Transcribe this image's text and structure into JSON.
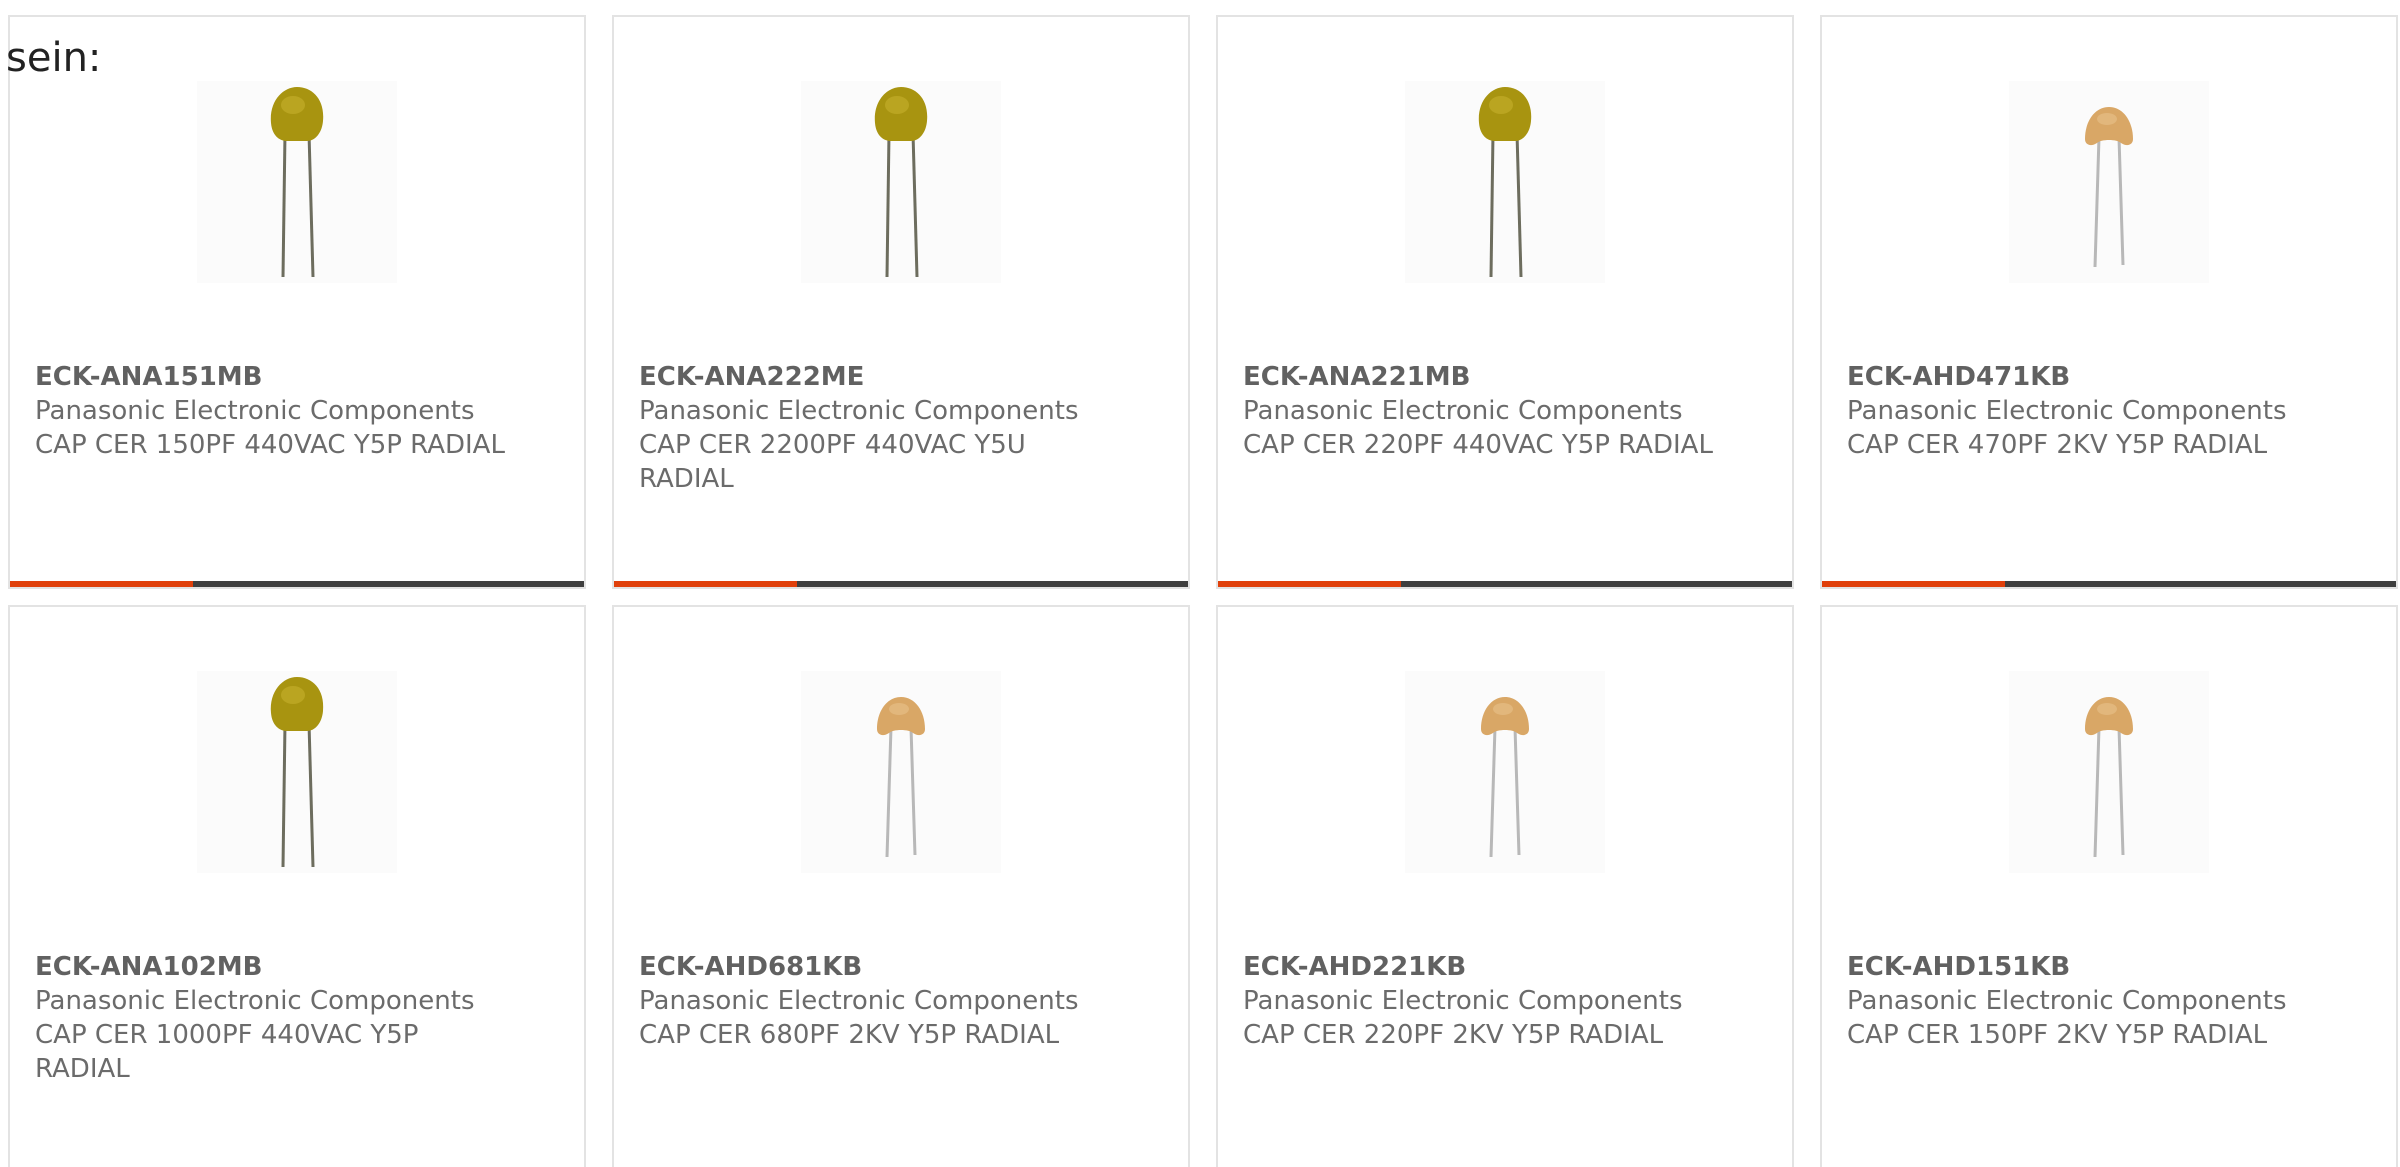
{
  "intro_text": "sein:",
  "colors": {
    "progress_fill": "#e0400b",
    "progress_track": "#3f3f3f",
    "card_border": "#e3e3e3",
    "text": "#6b6b6b"
  },
  "products": [
    {
      "part_number": "ECK-ANA151MB",
      "manufacturer": "Panasonic Electronic Components",
      "description": "CAP CER 150PF 440VAC Y5P RADIAL",
      "image_icon": "capacitor-olive-icon",
      "progress_fraction": 0.32
    },
    {
      "part_number": "ECK-ANA222ME",
      "manufacturer": "Panasonic Electronic Components",
      "description": "CAP CER 2200PF 440VAC Y5U RADIAL",
      "image_icon": "capacitor-olive-icon",
      "progress_fraction": 0.32
    },
    {
      "part_number": "ECK-ANA221MB",
      "manufacturer": "Panasonic Electronic Components",
      "description": "CAP CER 220PF 440VAC Y5P RADIAL",
      "image_icon": "capacitor-olive-icon",
      "progress_fraction": 0.32
    },
    {
      "part_number": "ECK-AHD471KB",
      "manufacturer": "Panasonic Electronic Components",
      "description": "CAP CER 470PF 2KV Y5P RADIAL",
      "image_icon": "capacitor-tan-icon",
      "progress_fraction": 0.32
    },
    {
      "part_number": "ECK-ANA102MB",
      "manufacturer": "Panasonic Electronic Components",
      "description": "CAP CER 1000PF 440VAC Y5P RADIAL",
      "image_icon": "capacitor-olive-icon"
    },
    {
      "part_number": "ECK-AHD681KB",
      "manufacturer": "Panasonic Electronic Components",
      "description": "CAP CER 680PF 2KV Y5P RADIAL",
      "image_icon": "capacitor-tan-icon"
    },
    {
      "part_number": "ECK-AHD221KB",
      "manufacturer": "Panasonic Electronic Components",
      "description": "CAP CER 220PF 2KV Y5P RADIAL",
      "image_icon": "capacitor-tan-icon"
    },
    {
      "part_number": "ECK-AHD151KB",
      "manufacturer": "Panasonic Electronic Components",
      "description": "CAP CER 150PF 2KV Y5P RADIAL",
      "image_icon": "capacitor-tan-icon"
    }
  ]
}
